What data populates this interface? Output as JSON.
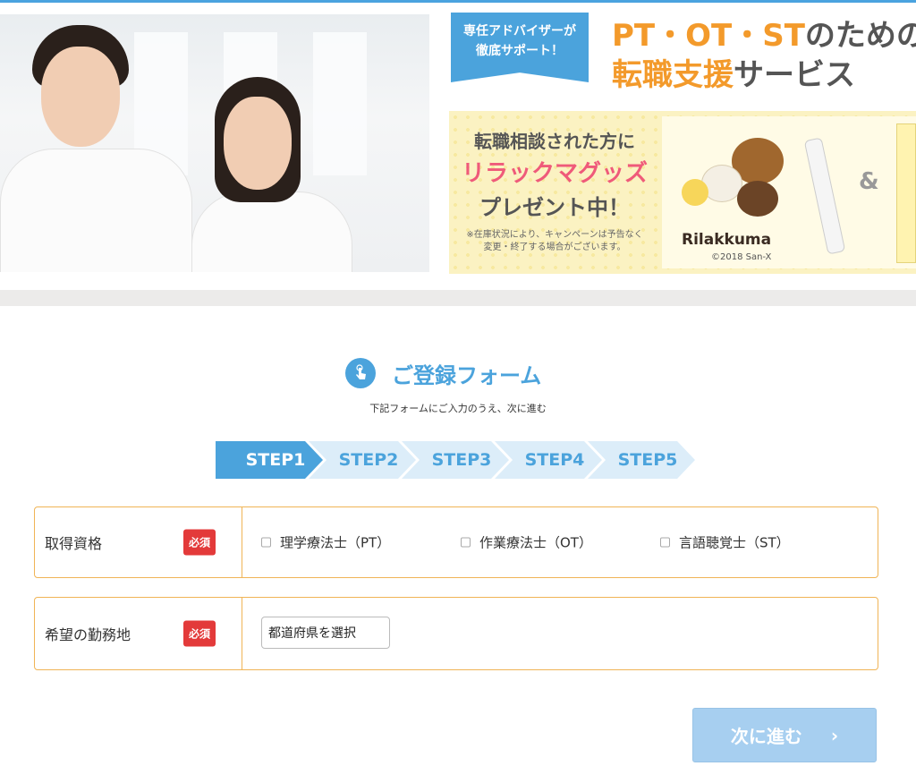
{
  "colors": {
    "accent": "#4ba3dc",
    "orange": "#f39a2b",
    "required": "#e33a3a",
    "row_border": "#f0b456",
    "promo_pink": "#ef5a7a"
  },
  "banner": {
    "badge_line1": "専任アドバイザーが",
    "badge_line2": "徹底サポート！",
    "headline_line1_orange": "PT・OT・ST",
    "headline_line1_rest": "のための",
    "headline_line2_orange": "転職支援",
    "headline_line2_rest": "サービス",
    "promo_line1": "転職相談された方に",
    "promo_line2": "リラックマグッズ",
    "promo_line3": "プレゼント中！",
    "promo_note_line1": "※在庫状況により、キャンペーンは予告なく",
    "promo_note_line2": "変更・終了する場合がございます。",
    "character_name": "Rilakkuma",
    "copyright": "©2018 San-X",
    "ampersand": "&"
  },
  "form": {
    "title": "ご登録フォーム",
    "subtitle": "下記フォームにご入力のうえ、次に進む",
    "steps": [
      "STEP1",
      "STEP2",
      "STEP3",
      "STEP4",
      "STEP5"
    ],
    "active_step": 1,
    "rows": [
      {
        "label": "取得資格",
        "required": "必須",
        "options": [
          "理学療法士（PT）",
          "作業療法士（OT）",
          "言語聴覚士（ST）"
        ]
      },
      {
        "label": "希望の勤務地",
        "required": "必須",
        "select_value": "都道府県を選択"
      }
    ],
    "next_label": "次に進む",
    "next_chevron": "›"
  },
  "icons": {
    "title_icon": "tap-hand-icon",
    "next_icon": "chevron-right-icon"
  }
}
